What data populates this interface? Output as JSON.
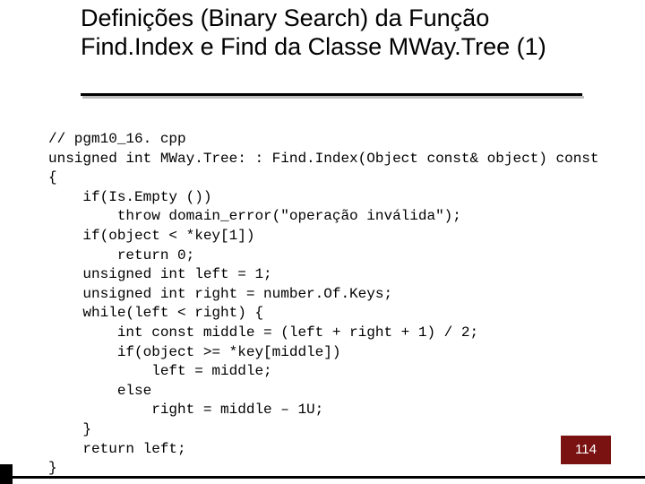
{
  "title": "Definições (Binary Search) da Função Find.Index e Find da Classe MWay.Tree (1)",
  "code": "// pgm10_16. cpp\nunsigned int MWay.Tree: : Find.Index(Object const& object) const\n{\n    if(Is.Empty ())\n        throw domain_error(\"operação inválida\");\n    if(object < *key[1])\n        return 0;\n    unsigned int left = 1;\n    unsigned int right = number.Of.Keys;\n    while(left < right) {\n        int const middle = (left + right + 1) / 2;\n        if(object >= *key[middle])\n            left = middle;\n        else\n            right = middle – 1U;\n    }\n    return left;\n}",
  "page_number": "114"
}
